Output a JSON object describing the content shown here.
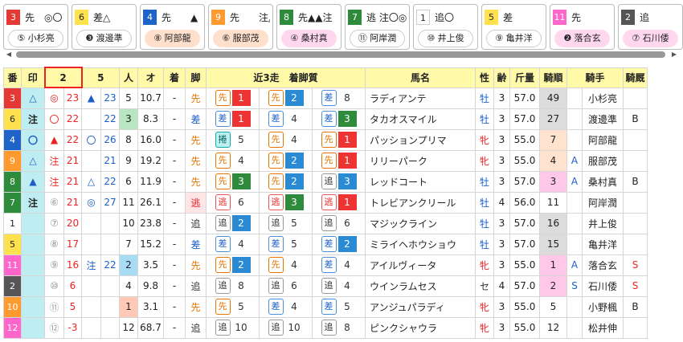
{
  "cards": [
    {
      "num": "3",
      "num_bg": "#e53935",
      "num_fg": "#ffffff",
      "top": "先　◎〇",
      "jockey": "⑤ 小杉亮",
      "style": ""
    },
    {
      "num": "6",
      "num_bg": "#ffe14d",
      "num_fg": "#222222",
      "top": "差△",
      "jockey": "❸ 渡邊準",
      "style": ""
    },
    {
      "num": "4",
      "num_bg": "#1e63c8",
      "num_fg": "#ffffff",
      "top": "先　　▲",
      "jockey": "⑧ 阿部龍",
      "style": "peach"
    },
    {
      "num": "9",
      "num_bg": "#ff9a2e",
      "num_fg": "#ffffff",
      "top": "先　　注△",
      "jockey": "⑥ 服部茂",
      "style": "peach"
    },
    {
      "num": "8",
      "num_bg": "#2e8b3b",
      "num_fg": "#ffffff",
      "top": "先▲▲注",
      "jockey": "④ 桑村真",
      "style": "pink"
    },
    {
      "num": "7",
      "num_bg": "#2e8b3b",
      "num_fg": "#ffffff",
      "top": "逃 注〇◎",
      "jockey": "⑪ 阿岸潤",
      "style": ""
    },
    {
      "num": "1",
      "num_bg": "#ffffff",
      "num_fg": "#222222",
      "top": "追〇",
      "jockey": "⑩ 井上俊",
      "style": ""
    },
    {
      "num": "5",
      "num_bg": "#ffe14d",
      "num_fg": "#222222",
      "top": "差",
      "jockey": "⑨ 亀井洋",
      "style": ""
    },
    {
      "num": "11",
      "num_bg": "#ff66cc",
      "num_fg": "#ffffff",
      "top": "先",
      "jockey": "❷ 落合玄",
      "style": "pink"
    },
    {
      "num": "2",
      "num_bg": "#555555",
      "num_fg": "#ffffff",
      "top": "追",
      "jockey": "⑦ 石川倭",
      "style": "pink"
    }
  ],
  "headers": {
    "ban": "番",
    "shirushi": "印",
    "col2": "2",
    "col5": "5",
    "nin": "人",
    "odds": "オ",
    "chaku": "着",
    "kyaku": "脚",
    "kinsan": "近3走　着脚質",
    "horse": "馬名",
    "sex": "性",
    "age": "齢",
    "weight": "斤量",
    "kijun": "騎順",
    "jockey": "騎手",
    "kyusha": "騎厩"
  },
  "rows": [
    {
      "num": "3",
      "num_bg": "#e53935",
      "num_fg": "#fff",
      "mark": "△",
      "m2": "◎",
      "m2c": "red",
      "v2": "23",
      "m5": "▲",
      "m5c": "blue",
      "v5": "23",
      "nin": "5",
      "odds": "10.7",
      "chaku": "-",
      "kyaku": "先",
      "kc": "sen",
      "r1t": "先",
      "r1c": "sen",
      "r1v": "1",
      "r1b": "b-red",
      "r2t": "先",
      "r2c": "sen",
      "r2v": "2",
      "r2b": "b-blue",
      "r3t": "差",
      "r3c": "sa",
      "r3v": "8",
      "r3b": "b-none",
      "horse": "ラディアンテ",
      "sex": "牡",
      "sc": "sex-m",
      "age": "3",
      "kin": "57.0",
      "kijun": "49",
      "kjc": "graybox",
      "a": "",
      "jockey": "小杉亮",
      "kyusha": "",
      "kyc": ""
    },
    {
      "num": "6",
      "num_bg": "#ffe14d",
      "num_fg": "#222",
      "mark": "注",
      "m2": "〇",
      "m2c": "red",
      "v2": "22",
      "m5": "",
      "m5c": "",
      "v5": "22",
      "nin": "3",
      "odds": "8.3",
      "chaku": "-",
      "kyaku": "差",
      "kc": "sa",
      "ninc": "green",
      "r1t": "差",
      "r1c": "sa",
      "r1v": "1",
      "r1b": "b-red",
      "r2t": "差",
      "r2c": "sa",
      "r2v": "4",
      "r2b": "b-none",
      "r3t": "差",
      "r3c": "sa",
      "r3v": "3",
      "r3b": "b-green",
      "horse": "タカオスマイル",
      "sex": "牡",
      "sc": "sex-m",
      "age": "3",
      "kin": "57.0",
      "kijun": "27",
      "kjc": "graybox",
      "a": "",
      "jockey": "渡邊準",
      "kyusha": "B",
      "kyc": ""
    },
    {
      "num": "4",
      "num_bg": "#1e63c8",
      "num_fg": "#fff",
      "mark": "〇",
      "m2": "▲",
      "m2c": "red",
      "v2": "22",
      "m5": "〇",
      "m5c": "blue",
      "v5": "26",
      "nin": "8",
      "odds": "16.0",
      "chaku": "-",
      "kyaku": "先",
      "kc": "sen",
      "r1t": "捲",
      "r1c": "maku",
      "r1v": "5",
      "r1b": "b-none",
      "r2t": "先",
      "r2c": "sen",
      "r2v": "4",
      "r2b": "b-none",
      "r3t": "先",
      "r3c": "sen",
      "r3v": "1",
      "r3b": "b-red",
      "horse": "パッションプリマ",
      "sex": "牝",
      "sc": "sex-f",
      "age": "3",
      "kin": "55.0",
      "kijun": "7",
      "kjc": "peachbg",
      "a": "",
      "jockey": "阿部龍",
      "kyusha": "",
      "kyc": ""
    },
    {
      "num": "9",
      "num_bg": "#ff9a2e",
      "num_fg": "#fff",
      "mark": "△",
      "m2": "注",
      "m2c": "red",
      "v2": "21",
      "m5": "",
      "m5c": "",
      "v5": "21",
      "nin": "9",
      "odds": "19.2",
      "chaku": "-",
      "kyaku": "先",
      "kc": "sen",
      "r1t": "先",
      "r1c": "sen",
      "r1v": "4",
      "r1b": "b-none",
      "r2t": "先",
      "r2c": "sen",
      "r2v": "2",
      "r2b": "b-blue",
      "r3t": "先",
      "r3c": "sen",
      "r3v": "1",
      "r3b": "b-red",
      "horse": "リリーパーク",
      "sex": "牝",
      "sc": "sex-f",
      "age": "3",
      "kin": "55.0",
      "kijun": "4",
      "kjc": "peachbg",
      "a": "A",
      "jockey": "服部茂",
      "kyusha": "",
      "kyc": ""
    },
    {
      "num": "8",
      "num_bg": "#2e8b3b",
      "num_fg": "#fff",
      "mark": "▲",
      "m2": "注",
      "m2c": "red",
      "v2": "21",
      "m5": "△",
      "m5c": "blue",
      "v5": "22",
      "nin": "6",
      "odds": "11.9",
      "chaku": "-",
      "kyaku": "先",
      "kc": "sen",
      "r1t": "先",
      "r1c": "sen",
      "r1v": "3",
      "r1b": "b-green",
      "r2t": "先",
      "r2c": "sen",
      "r2v": "2",
      "r2b": "b-blue",
      "r3t": "追",
      "r3c": "oi",
      "r3v": "3",
      "r3b": "b-blue",
      "horse": "レッドコート",
      "sex": "牡",
      "sc": "sex-m",
      "age": "3",
      "kin": "57.0",
      "kijun": "3",
      "kjc": "pinkrank",
      "a": "A",
      "jockey": "桑村真",
      "kyusha": "B",
      "kyc": ""
    },
    {
      "num": "7",
      "num_bg": "#2e8b3b",
      "num_fg": "#fff",
      "mark": "注",
      "m2": "⑥",
      "m2c": "dim",
      "v2": "21",
      "m5": "◎",
      "m5c": "blue",
      "v5": "27",
      "nin": "11",
      "odds": "26.1",
      "chaku": "-",
      "kyaku": "逃",
      "kc": "nige",
      "r1t": "逃",
      "r1c": "nige",
      "r1v": "6",
      "r1b": "b-none",
      "r2t": "逃",
      "r2c": "nige",
      "r2v": "3",
      "r2b": "b-green",
      "r3t": "逃",
      "r3c": "nige",
      "r3v": "1",
      "r3b": "b-red",
      "horse": "トレビアンクリール",
      "sex": "牡",
      "sc": "sex-m",
      "age": "4",
      "kin": "56.0",
      "kijun": "11",
      "kjc": "",
      "a": "",
      "jockey": "阿岸潤",
      "kyusha": "",
      "kyc": ""
    },
    {
      "num": "1",
      "num_bg": "#fff",
      "num_fg": "#222",
      "mark": "",
      "m2": "⑦",
      "m2c": "dim",
      "v2": "20",
      "m5": "",
      "m5c": "",
      "v5": "",
      "nin": "10",
      "odds": "23.8",
      "chaku": "-",
      "kyaku": "追",
      "kc": "oi",
      "r1t": "追",
      "r1c": "oi",
      "r1v": "2",
      "r1b": "b-blue",
      "r2t": "追",
      "r2c": "oi",
      "r2v": "5",
      "r2b": "b-none",
      "r3t": "追",
      "r3c": "oi",
      "r3v": "6",
      "r3b": "b-none",
      "horse": "マジックライン",
      "sex": "牡",
      "sc": "sex-m",
      "age": "3",
      "kin": "57.0",
      "kijun": "16",
      "kjc": "graybox",
      "a": "",
      "jockey": "井上俊",
      "kyusha": "",
      "kyc": ""
    },
    {
      "num": "5",
      "num_bg": "#ffe14d",
      "num_fg": "#222",
      "mark": "",
      "m2": "⑧",
      "m2c": "dim",
      "v2": "17",
      "m5": "",
      "m5c": "",
      "v5": "",
      "nin": "7",
      "odds": "15.2",
      "chaku": "-",
      "kyaku": "差",
      "kc": "sa",
      "r1t": "差",
      "r1c": "sa",
      "r1v": "4",
      "r1b": "b-none",
      "r2t": "差",
      "r2c": "sa",
      "r2v": "5",
      "r2b": "b-none",
      "r3t": "差",
      "r3c": "sa",
      "r3v": "2",
      "r3b": "b-blue",
      "horse": "ミライヘホウショウ",
      "sex": "牡",
      "sc": "sex-m",
      "age": "3",
      "kin": "57.0",
      "kijun": "15",
      "kjc": "graybox",
      "a": "",
      "jockey": "亀井洋",
      "kyusha": "",
      "kyc": ""
    },
    {
      "num": "11",
      "num_bg": "#ff66cc",
      "num_fg": "#fff",
      "mark": "",
      "m2": "⑨",
      "m2c": "dim",
      "v2": "16",
      "m5": "注",
      "m5c": "blue",
      "v5": "22",
      "nin": "2",
      "odds": "3.5",
      "chaku": "-",
      "kyaku": "先",
      "kc": "sen",
      "ninc": "skyblue",
      "r1t": "先",
      "r1c": "sen",
      "r1v": "2",
      "r1b": "b-blue",
      "r2t": "先",
      "r2c": "sen",
      "r2v": "4",
      "r2b": "b-none",
      "r3t": "差",
      "r3c": "sa",
      "r3v": "4",
      "r3b": "b-none",
      "horse": "アイルヴィータ",
      "sex": "牝",
      "sc": "sex-f",
      "age": "3",
      "kin": "55.0",
      "kijun": "1",
      "kjc": "pinkrank",
      "a": "A",
      "jockey": "落合玄",
      "kyusha": "S",
      "kyc": "red"
    },
    {
      "num": "2",
      "num_bg": "#555",
      "num_fg": "#fff",
      "mark": "",
      "m2": "⑩",
      "m2c": "dim",
      "v2": "6",
      "m5": "",
      "m5c": "",
      "v5": "",
      "nin": "4",
      "odds": "9.8",
      "chaku": "-",
      "kyaku": "追",
      "kc": "oi",
      "r1t": "追",
      "r1c": "oi",
      "r1v": "8",
      "r1b": "b-none",
      "r2t": "追",
      "r2c": "oi",
      "r2v": "6",
      "r2b": "b-none",
      "r3t": "追",
      "r3c": "oi",
      "r3v": "4",
      "r3b": "b-none",
      "horse": "ウインラムセス",
      "sex": "セ",
      "sc": "sex-g",
      "age": "4",
      "kin": "57.0",
      "kijun": "2",
      "kjc": "pinkrank",
      "a": "S",
      "jockey": "石川倭",
      "kyusha": "S",
      "kyc": "red"
    },
    {
      "num": "10",
      "num_bg": "#ff9a2e",
      "num_fg": "#fff",
      "mark": "",
      "m2": "⑪",
      "m2c": "dim",
      "v2": "5",
      "m5": "",
      "m5c": "",
      "v5": "",
      "nin": "1",
      "odds": "3.1",
      "chaku": "-",
      "kyaku": "先",
      "kc": "sen",
      "ninc": "salmon",
      "r1t": "先",
      "r1c": "sen",
      "r1v": "5",
      "r1b": "b-none",
      "r2t": "差",
      "r2c": "sa",
      "r2v": "4",
      "r2b": "b-none",
      "r3t": "差",
      "r3c": "sa",
      "r3v": "5",
      "r3b": "b-none",
      "horse": "アンジュパラディ",
      "sex": "牝",
      "sc": "sex-f",
      "age": "3",
      "kin": "55.0",
      "kijun": "5",
      "kjc": "",
      "a": "",
      "jockey": "小野楓",
      "kyusha": "B",
      "kyc": ""
    },
    {
      "num": "12",
      "num_bg": "#ff66cc",
      "num_fg": "#fff",
      "mark": "",
      "m2": "⑫",
      "m2c": "dim",
      "v2": "-3",
      "m5": "",
      "m5c": "",
      "v5": "",
      "nin": "12",
      "odds": "68.7",
      "chaku": "-",
      "kyaku": "追",
      "kc": "oi",
      "r1t": "追",
      "r1c": "oi",
      "r1v": "10",
      "r1b": "b-none",
      "r2t": "追",
      "r2c": "oi",
      "r2v": "10",
      "r2b": "b-none",
      "r3t": "追",
      "r3c": "oi",
      "r3v": "8",
      "r3b": "b-none",
      "horse": "ピンクシャウラ",
      "sex": "牝",
      "sc": "sex-f",
      "age": "3",
      "kin": "55.0",
      "kijun": "12",
      "kjc": "",
      "a": "",
      "jockey": "松井伸",
      "kyusha": "",
      "kyc": ""
    }
  ],
  "scroll": {
    "left_arrow": "◀",
    "right_arrow": "▶"
  }
}
